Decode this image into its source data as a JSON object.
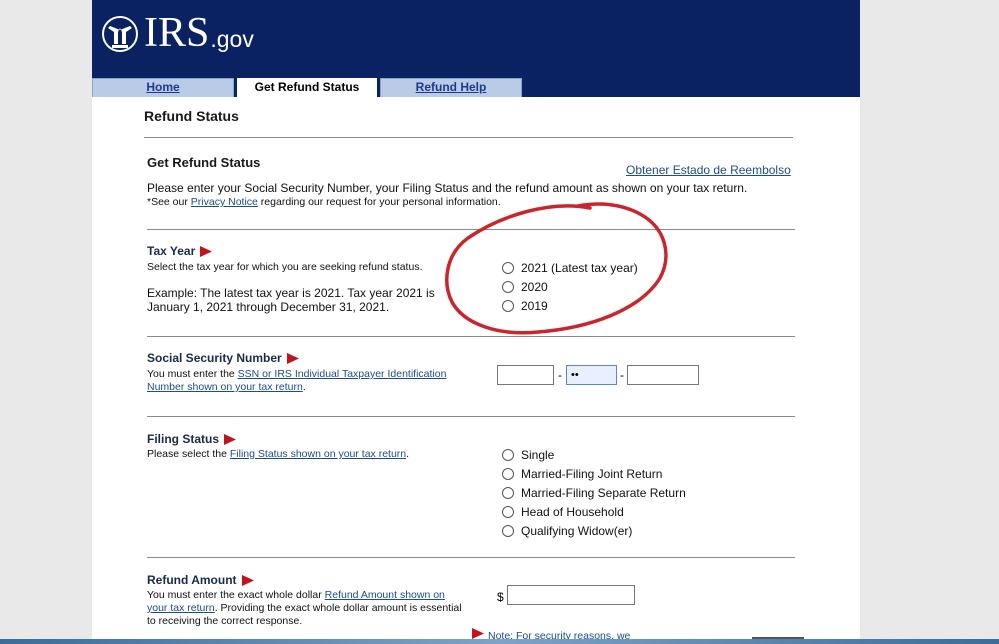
{
  "logo": {
    "text": "IRS",
    "suffix": ".gov"
  },
  "tabs": [
    {
      "label": "Home",
      "active": false
    },
    {
      "label": "Get Refund Status",
      "active": true
    },
    {
      "label": "Refund Help",
      "active": false
    }
  ],
  "page_title": "Refund Status",
  "intro": {
    "heading": "Get Refund Status",
    "spanish_link": "Obtener Estado de Reembolso",
    "instructions": "Please enter your Social Security Number, your Filing Status and the refund amount as shown on your tax return.",
    "privacy_prefix": "*See our ",
    "privacy_link": "Privacy Notice",
    "privacy_suffix": " regarding our request for your personal information."
  },
  "tax_year": {
    "heading": "Tax Year",
    "description": "Select the tax year for which you are seeking refund status.",
    "example": "Example: The latest tax year is 2021. Tax year 2021 is January 1, 2021 through December 31, 2021.",
    "options": [
      "2021 (Latest tax year)",
      "2020",
      "2019"
    ]
  },
  "ssn": {
    "heading": "Social Security Number",
    "prefix": "You must enter the ",
    "link": "SSN or IRS Individual Taxpayer Identification Number shown on your tax return",
    "suffix": ".",
    "field1_value": "",
    "field2_value": "••",
    "field3_value": "",
    "separator": "-"
  },
  "filing_status": {
    "heading": "Filing Status",
    "prefix": "Please select the ",
    "link": "Filing Status shown on your tax return",
    "suffix": ".",
    "options": [
      "Single",
      "Married-Filing Joint Return",
      "Married-Filing Separate Return",
      "Head of Household",
      "Qualifying Widow(er)"
    ]
  },
  "refund_amount": {
    "heading": "Refund Amount",
    "prefix": "You must enter the exact whole dollar ",
    "link": "Refund Amount shown on your tax return",
    "suffix": ". Providing the exact whole dollar amount is essential to receiving the correct response.",
    "currency": "$",
    "value": ""
  },
  "security_note": "Note: For security reasons, we",
  "colors": {
    "banner": "#0b2262",
    "link": "#1c4b8f",
    "flag": "#c0141c",
    "annotation_circle": "#c8262c"
  }
}
